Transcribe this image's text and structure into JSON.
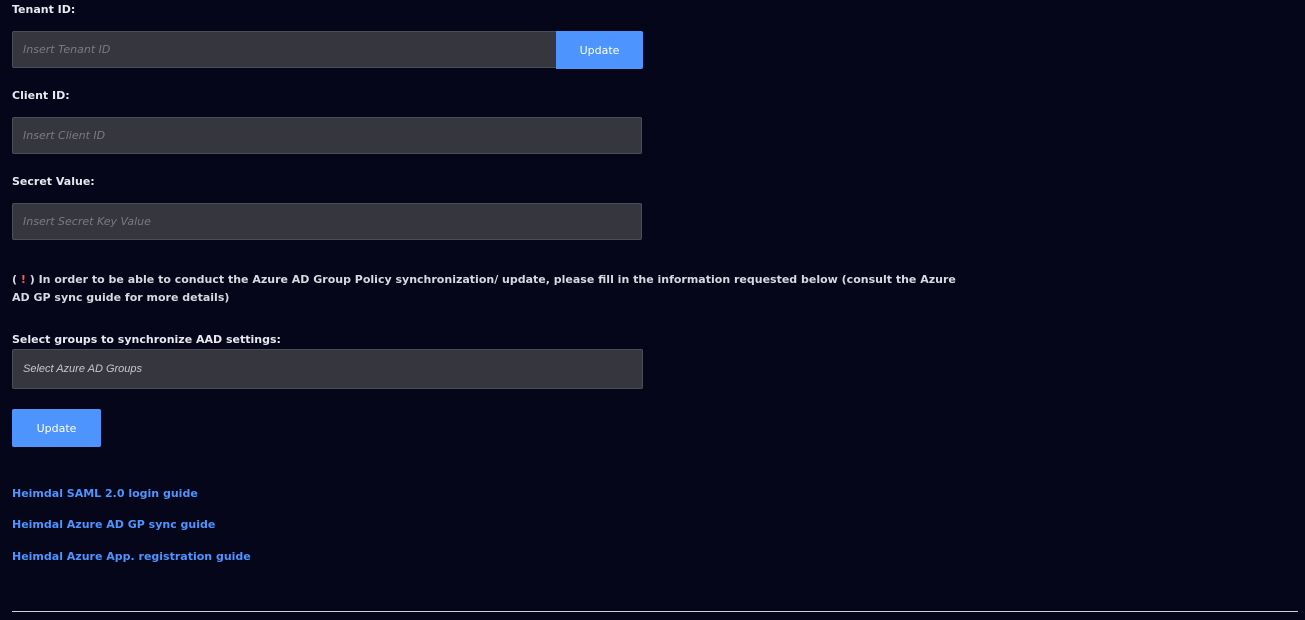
{
  "tenant": {
    "label": "Tenant ID:",
    "placeholder": "Insert Tenant ID",
    "value": "",
    "button_label": "Update"
  },
  "client": {
    "label": "Client ID:",
    "placeholder": "Insert Client ID",
    "value": ""
  },
  "secret": {
    "label": "Secret Value:",
    "placeholder": "Insert Secret Key Value",
    "value": ""
  },
  "notice": {
    "open": "(",
    "mark": " ! ",
    "close": ")",
    "text": " In order to be able to conduct the Azure AD Group Policy synchronization/ update, please fill in the information requested below (consult the Azure AD GP sync guide for more details)"
  },
  "groups": {
    "label": "Select groups to synchronize AAD settings:",
    "placeholder": "Select Azure AD Groups"
  },
  "update_button": "Update",
  "links": [
    "Heimdal SAML 2.0 login guide",
    "Heimdal Azure AD GP sync guide",
    "Heimdal Azure App. registration guide"
  ],
  "colors": {
    "background": "#06061a",
    "field_bg": "#36363f",
    "accent": "#4d94ff",
    "warning": "#ff5a4a"
  }
}
